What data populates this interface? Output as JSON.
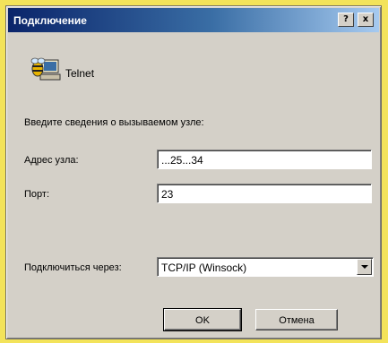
{
  "dialog": {
    "title": "Подключение",
    "help_label": "?",
    "close_label": "x",
    "app_icon": "telnet-computer-icon",
    "app_name": "Telnet",
    "instruction": "Введите сведения о вызываемом узле:",
    "host_label": "Адрес узла:",
    "host_value": "...25...34",
    "port_label": "Порт:",
    "port_value": "23",
    "connect_via_label": "Подключиться через:",
    "connect_via_value": "TCP/IP (Winsock)",
    "ok_label": "OK",
    "cancel_label": "Отмена"
  }
}
